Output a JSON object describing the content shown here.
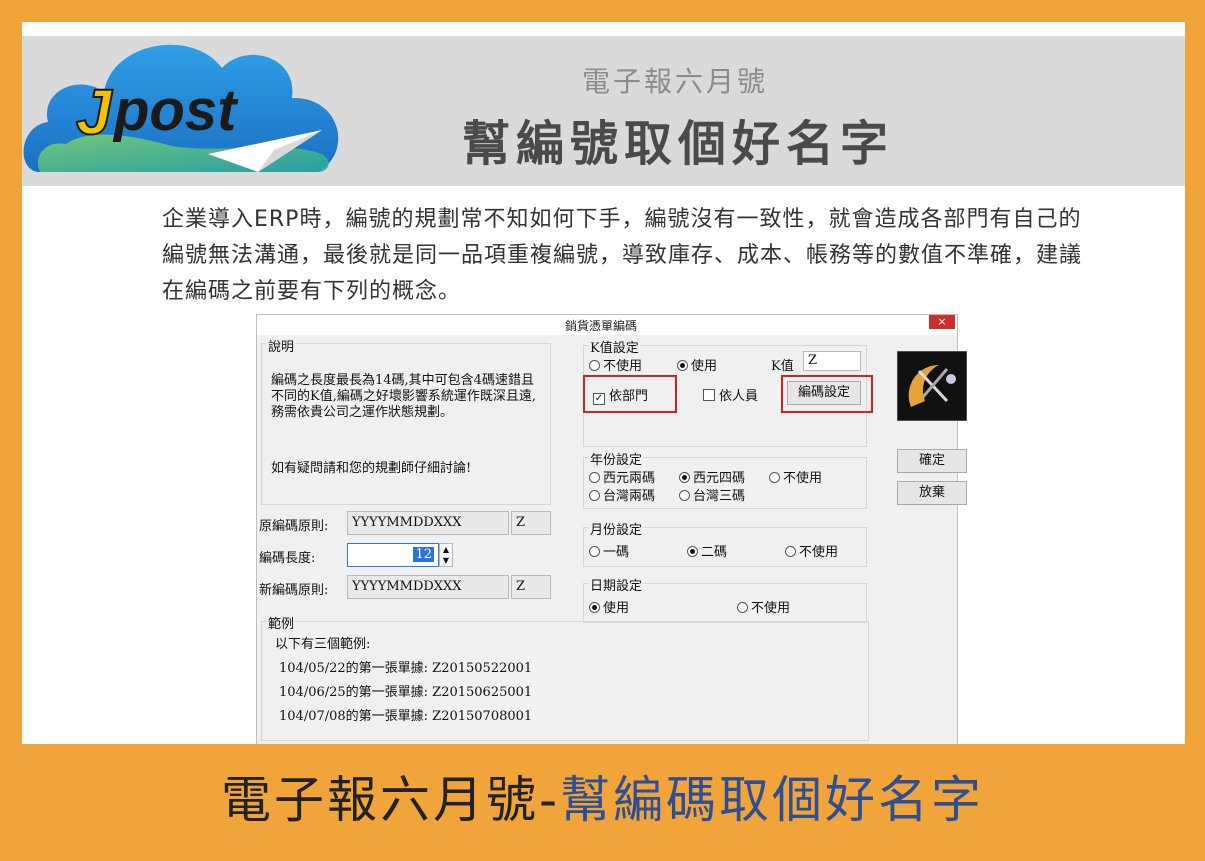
{
  "header": {
    "logo_text": "Jpost",
    "subtitle": "電子報六月號",
    "title": "幫編號取個好名字"
  },
  "intro": "企業導入ERP時，編號的規劃常不知如何下手，編號沒有一致性，就會造成各部門有自己的編號無法溝通，最後就是同一品項重複編號，導致庫存、成本、帳務等的數值不準確，建議在編碼之前要有下列的概念。",
  "dialog": {
    "title": "銷貨憑單編碼",
    "close_label": "×",
    "desc": {
      "label": "說明",
      "text1": "編碼之長度最長為14碼,其中可包含4碼速錯且不同的K值,編碼之好壞影響系統運作既深且遠, 務需依貴公司之運作狀態規劃。",
      "text2": "如有疑問請和您的規劃師仔細討論!"
    },
    "fields": {
      "orig_label": "原編碼原則:",
      "orig_value": "YYYYMMDDXXX",
      "orig_suffix": "Z",
      "length_label": "編碼長度:",
      "length_value": "12",
      "new_label": "新編碼原則:",
      "new_value": "YYYYMMDDXXX",
      "new_suffix": "Z"
    },
    "example": {
      "label": "範例",
      "intro": "以下有三個範例:",
      "items": [
        "104/05/22的第一張單據: Z20150522001",
        "104/06/25的第一張單據: Z20150625001",
        "104/07/08的第一張單據: Z20150708001"
      ]
    },
    "k": {
      "label": "K值設定",
      "off": "不使用",
      "on": "使用",
      "value_label": "K值",
      "value": "Z",
      "by_dept": "依部門",
      "by_person": "依人員",
      "code_setting": "編碼設定"
    },
    "year": {
      "label": "年份設定",
      "options": [
        "西元兩碼",
        "西元四碼",
        "不使用",
        "台灣兩碼",
        "台灣三碼"
      ]
    },
    "month": {
      "label": "月份設定",
      "options": [
        "一碼",
        "二碼",
        "不使用"
      ]
    },
    "date": {
      "label": "日期設定",
      "options": [
        "使用",
        "不使用"
      ]
    },
    "buttons": {
      "confirm": "確定",
      "cancel": "放棄"
    }
  },
  "footer": {
    "part1": "電子報六月號-",
    "part2": "幫編碼取個好名字"
  },
  "colors": {
    "border": "#F0A43A",
    "header_band": "#DADADA",
    "footer_accent": "#2E4F93",
    "highlight": "#D62020"
  }
}
